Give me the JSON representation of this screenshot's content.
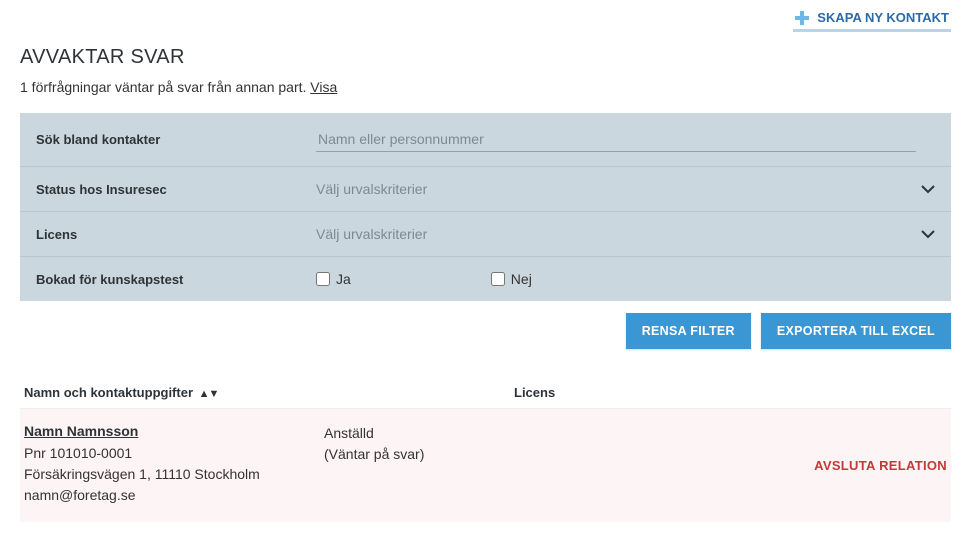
{
  "topbar": {
    "create_label": "SKAPA NY KONTAKT"
  },
  "header": {
    "title": "AVVAKTAR SVAR",
    "pending_prefix": "1 förfrågningar väntar på svar från annan part. ",
    "pending_link": "Visa"
  },
  "filters": {
    "search": {
      "label": "Sök bland kontakter",
      "placeholder": "Namn eller personnummer",
      "value": ""
    },
    "status": {
      "label": "Status hos Insuresec",
      "placeholder": "Välj urvalskriterier"
    },
    "license": {
      "label": "Licens",
      "placeholder": "Välj urvalskriterier"
    },
    "booked": {
      "label": "Bokad för kunskapstest",
      "option_yes": "Ja",
      "option_no": "Nej"
    }
  },
  "actions": {
    "clear": "RENSA FILTER",
    "export": "EXPORTERA TILL EXCEL"
  },
  "table": {
    "columns": {
      "name": "Namn och kontaktuppgifter",
      "license": "Licens"
    },
    "rows": [
      {
        "name": "Namn Namnsson",
        "pnr": "Pnr 101010-0001",
        "address": "Försäkringsvägen 1, 11110 Stockholm",
        "email": "namn@foretag.se",
        "role": "Anställd",
        "status": "(Väntar på svar)",
        "action": "AVSLUTA RELATION"
      }
    ]
  }
}
